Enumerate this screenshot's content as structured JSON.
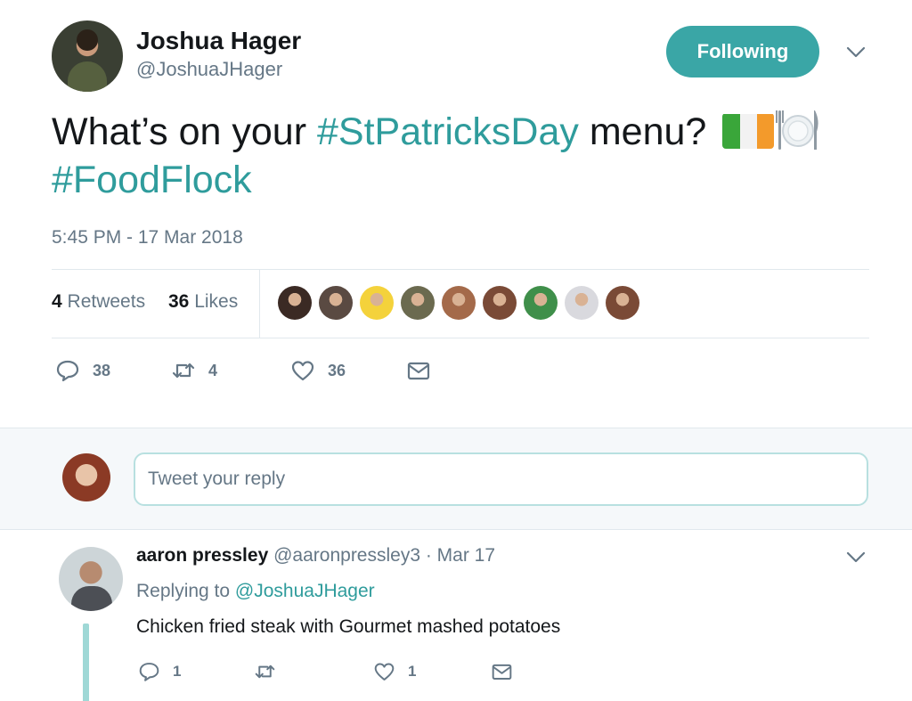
{
  "tweet": {
    "author_name": "Joshua Hager",
    "author_handle": "@JoshuaJHager",
    "follow_label": "Following",
    "text_pre": "What’s on your ",
    "hashtag1": "#StPatricksDay",
    "text_mid": " menu? ",
    "hashtag2": "#FoodFlock",
    "timestamp": "5:45 PM - 17 Mar 2018",
    "retweet_count": "4",
    "retweets_label": "Retweets",
    "like_count": "36",
    "likes_label": "Likes",
    "liker_colors": [
      "#3b2a24",
      "#5a4a42",
      "#f4d23b",
      "#6b6a4f",
      "#a46a4a",
      "#7a4a36",
      "#3f8f4a",
      "#d9d9de",
      "#7a4a36"
    ],
    "actions": {
      "reply_count": "38",
      "retweet_count": "4",
      "like_count": "36"
    }
  },
  "reply_box": {
    "placeholder": "Tweet your reply"
  },
  "reply": {
    "name": "aaron pressley",
    "handle": "@aaronpressley3",
    "date": "· Mar 17",
    "replying_prefix": "Replying to ",
    "replying_to": "@JoshuaJHager",
    "text": "Chicken fried steak with Gourmet mashed potatoes",
    "actions": {
      "reply_count": "1",
      "like_count": "1"
    }
  },
  "colors": {
    "accent": "#3aa6a6",
    "hashtag": "#2f9c9c",
    "muted": "#657786",
    "thread": "#9fd8d6"
  },
  "icons": [
    "chevron-down-icon",
    "reply-icon",
    "retweet-icon",
    "like-icon",
    "message-icon",
    "ireland-flag-icon",
    "fork-knife-plate-icon"
  ]
}
